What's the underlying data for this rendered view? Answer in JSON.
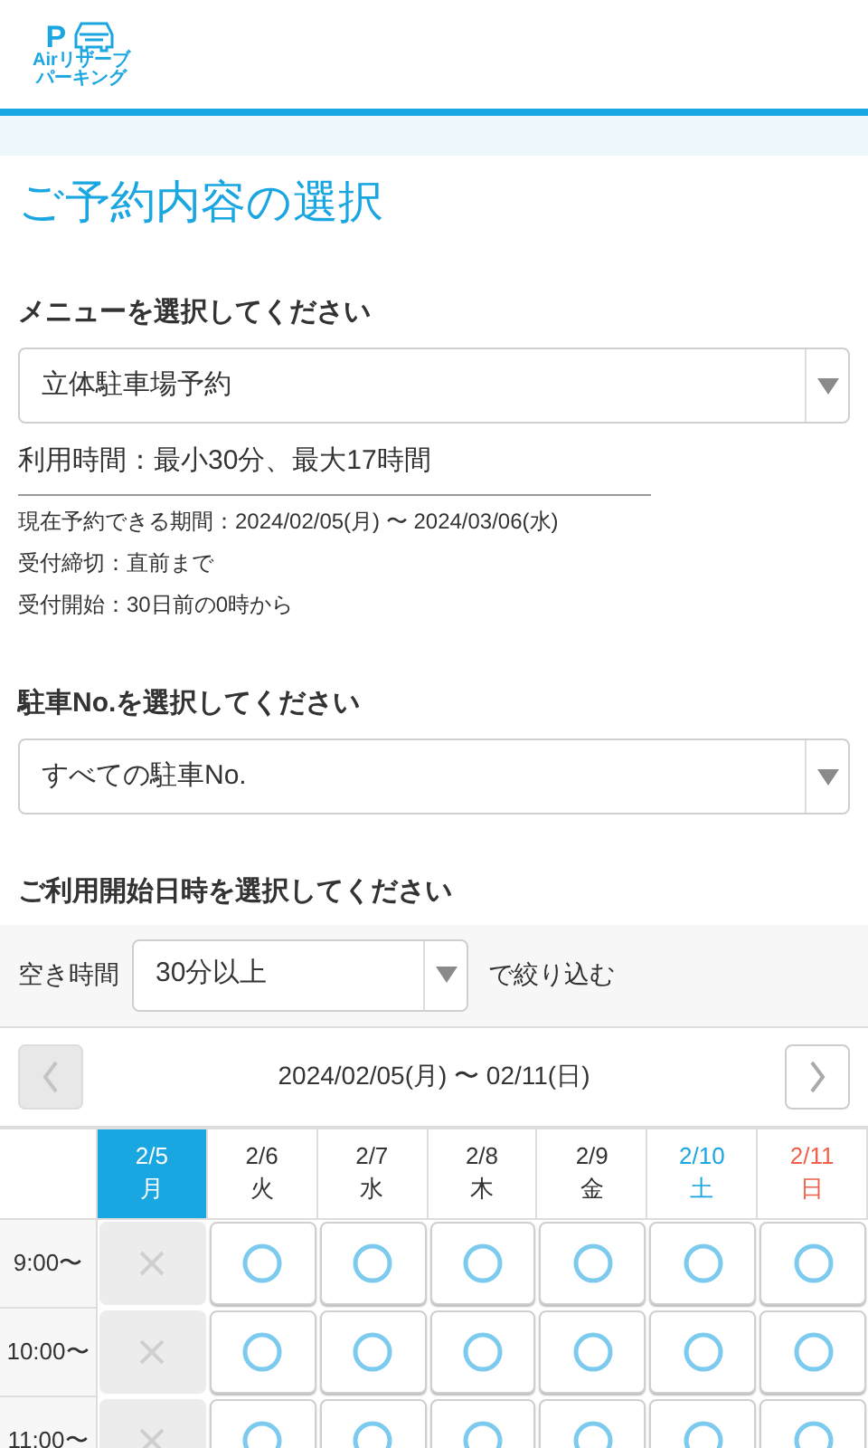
{
  "logo": {
    "letter": "P",
    "lines": [
      "Airリザーブ",
      "パーキング"
    ]
  },
  "title": "ご予約内容の選択",
  "menu": {
    "label": "メニューを選択してください",
    "value": "立体駐車場予約"
  },
  "usage": "利用時間：最小30分、最大17時間",
  "info": [
    "現在予約できる期間：2024/02/05(月) 〜 2024/03/06(水)",
    "受付締切：直前まで",
    "受付開始：30日前の0時から"
  ],
  "spot": {
    "label": "駐車No.を選択してください",
    "value": "すべての駐車No."
  },
  "start_label": "ご利用開始日時を選択してください",
  "filter": {
    "label": "空き時間",
    "value": "30分以上",
    "suffix": "で絞り込む"
  },
  "week": {
    "range": "2024/02/05(月) 〜 02/11(日)",
    "prev_disabled": true,
    "next_disabled": false
  },
  "days": [
    {
      "date": "2/5",
      "weekday": "月",
      "kind": "weekday",
      "selected": true
    },
    {
      "date": "2/6",
      "weekday": "火",
      "kind": "weekday",
      "selected": false
    },
    {
      "date": "2/7",
      "weekday": "水",
      "kind": "weekday",
      "selected": false
    },
    {
      "date": "2/8",
      "weekday": "木",
      "kind": "weekday",
      "selected": false
    },
    {
      "date": "2/9",
      "weekday": "金",
      "kind": "weekday",
      "selected": false
    },
    {
      "date": "2/10",
      "weekday": "土",
      "kind": "saturday",
      "selected": false
    },
    {
      "date": "2/11",
      "weekday": "日",
      "kind": "sunday",
      "selected": false
    }
  ],
  "rows": [
    {
      "time": "9:00〜",
      "slots": [
        {
          "kind": "unavailable"
        },
        {
          "kind": "available"
        },
        {
          "kind": "available"
        },
        {
          "kind": "available"
        },
        {
          "kind": "available"
        },
        {
          "kind": "available"
        },
        {
          "kind": "available"
        }
      ]
    },
    {
      "time": "10:00〜",
      "slots": [
        {
          "kind": "unavailable"
        },
        {
          "kind": "available"
        },
        {
          "kind": "available"
        },
        {
          "kind": "available"
        },
        {
          "kind": "available"
        },
        {
          "kind": "available"
        },
        {
          "kind": "available"
        }
      ]
    },
    {
      "time": "11:00〜",
      "slots": [
        {
          "kind": "unavailable"
        },
        {
          "kind": "available"
        },
        {
          "kind": "available"
        },
        {
          "kind": "available"
        },
        {
          "kind": "available"
        },
        {
          "kind": "available"
        },
        {
          "kind": "available"
        }
      ]
    }
  ]
}
